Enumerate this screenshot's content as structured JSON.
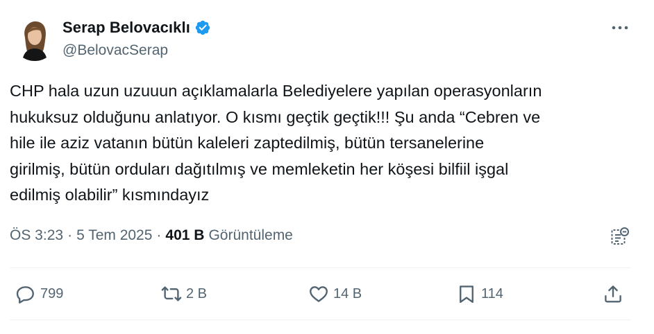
{
  "author": {
    "name": "Serap Belovacıklı",
    "handle": "@BelovacSerap",
    "verified_color": "#1d9bf0"
  },
  "tweet": {
    "lines": [
      "CHP hala uzun uzuuun açıklamalarla Belediyelere yapılan operasyonların",
      "hukuksuz olduğunu anlatıyor. O kısmı geçtik geçtik!!! Şu anda “Cebren ve",
      "hile ile aziz vatanın bütün kaleleri zaptedilmiş, bütün tersanelerine",
      "girilmiş, bütün orduları dağıtılmış ve memleketin her köşesi bilfiil işgal",
      "edilmiş olabilir” kısmındayız"
    ]
  },
  "meta": {
    "time": "ÖS 3:23",
    "separator": "·",
    "date": "5 Tem 2025",
    "views_count": "401 B",
    "views_label": "Görüntüleme"
  },
  "actions": {
    "replies": "799",
    "reposts": "2 B",
    "likes": "14 B",
    "bookmarks": "114"
  },
  "icons": [
    "more-icon",
    "analytics-icon",
    "reply-icon",
    "repost-icon",
    "like-icon",
    "bookmark-icon",
    "share-icon",
    "verified-badge-icon"
  ],
  "colors": {
    "text": "#0f1419",
    "secondary": "#536471",
    "divider": "#eff3f4",
    "accent": "#1d9bf0"
  }
}
